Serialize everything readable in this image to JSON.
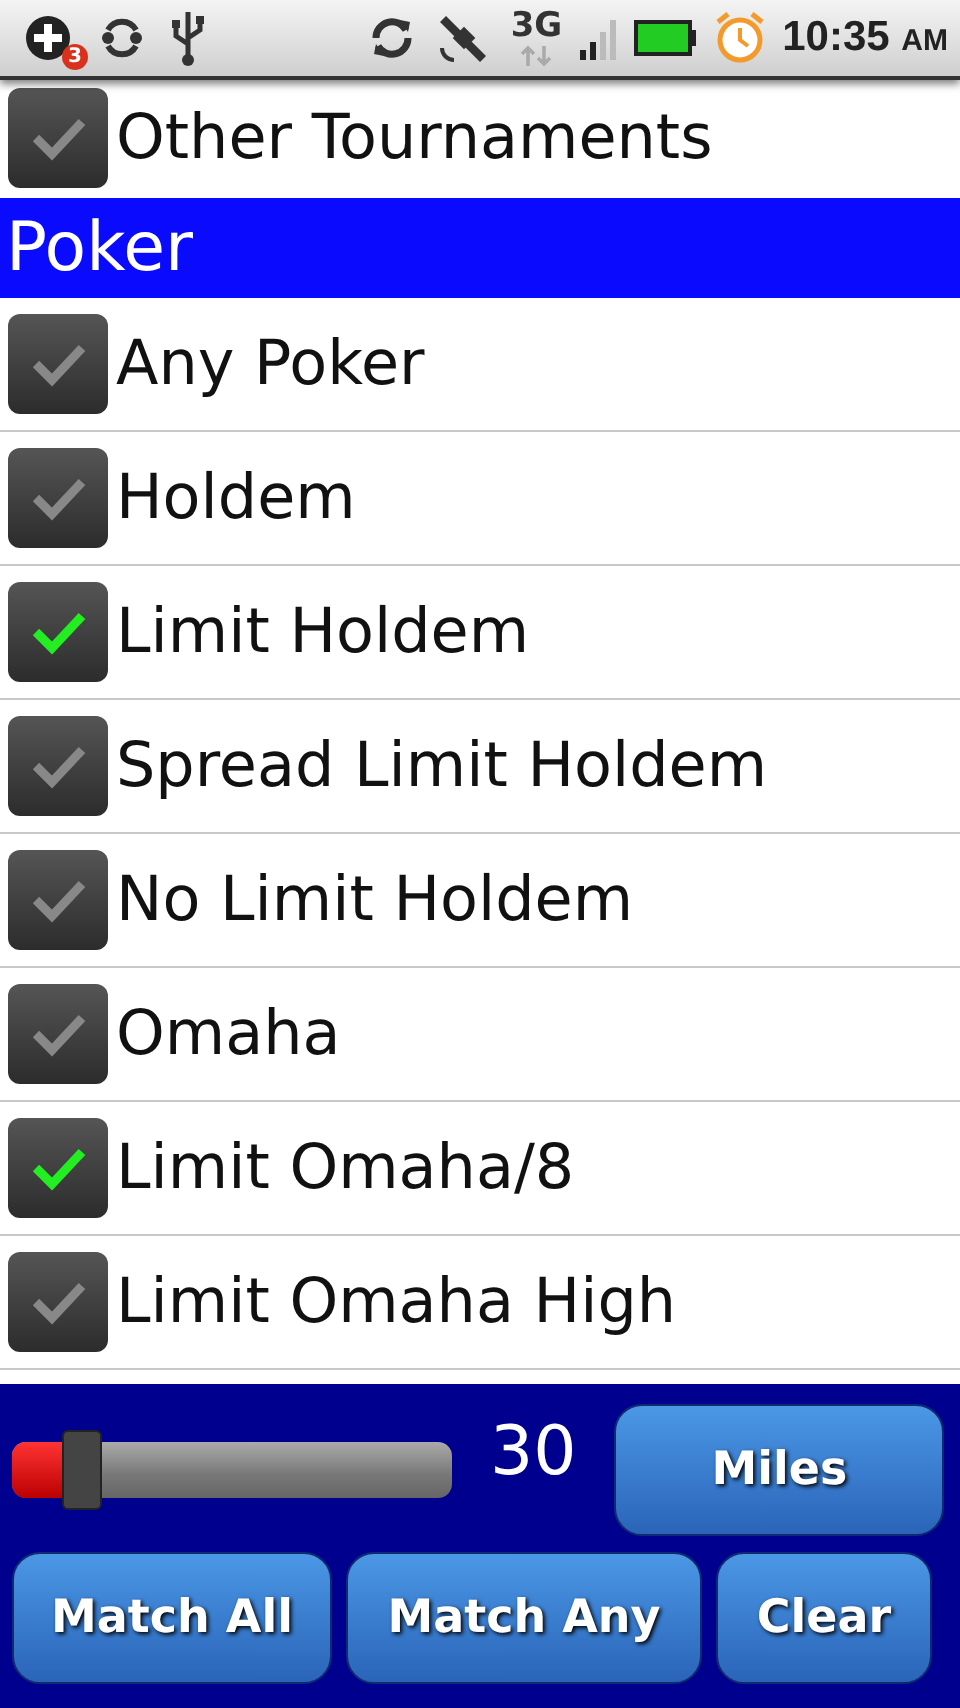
{
  "status_bar": {
    "notification_count": "3",
    "network": "3G",
    "time": "10:35",
    "ampm": "AM"
  },
  "partial_top_item": {
    "label": "Other Tournaments",
    "checked": false
  },
  "section": {
    "title": "Poker"
  },
  "items": [
    {
      "label": "Any Poker",
      "checked": false
    },
    {
      "label": "Holdem",
      "checked": false
    },
    {
      "label": "Limit Holdem",
      "checked": true
    },
    {
      "label": "Spread Limit Holdem",
      "checked": false
    },
    {
      "label": "No Limit Holdem",
      "checked": false
    },
    {
      "label": "Omaha",
      "checked": false
    },
    {
      "label": "Limit Omaha/8",
      "checked": true
    },
    {
      "label": "Limit Omaha High",
      "checked": false
    }
  ],
  "distance": {
    "level": 0.13,
    "reading": "30",
    "unit_button": "Miles"
  },
  "buttons": [
    "Match All",
    "Match Any",
    "Clear"
  ]
}
